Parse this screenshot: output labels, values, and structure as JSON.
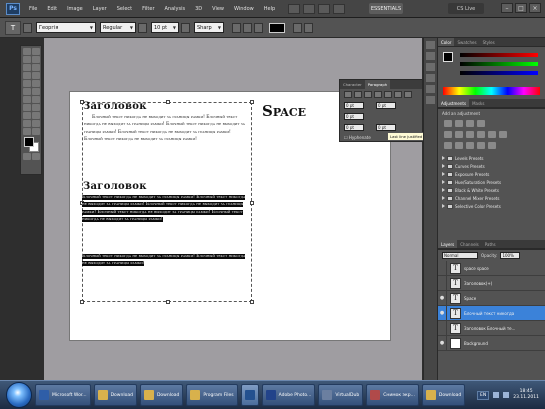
{
  "app": {
    "logo": "Ps",
    "menu": [
      "File",
      "Edit",
      "Image",
      "Layer",
      "Select",
      "Filter",
      "Analysis",
      "3D",
      "View",
      "Window",
      "Help"
    ],
    "workspace": "ESSENTIALS",
    "cs_live": "CS Live",
    "window_buttons": [
      "–",
      "□",
      "×"
    ]
  },
  "options_bar": {
    "tool_glyph": "T",
    "font_family": "Георгія",
    "font_style": "Regular",
    "font_size": "10 pt",
    "antialias": "Sharp",
    "text_color": "#000000"
  },
  "document": {
    "heading1": "Заголовок",
    "body1": "Блочный текст никогда не выходит за границы рамки! Блочный текст никогда не выходит за границы рамки! Блочный текст никогда не выходит за границы рамки! Блочный текст никогда не выходит за границы рамки! Блочный текст никогда не выходит за границы рамки!",
    "heading2": "Заголовок",
    "body2_selected": "Блочный текст никогда не выходит за границы рамки! Блочный текст никогда не выходит за границы рамки! Блочный текст никогда не выходит за границы рамки! Блочный текст никогда не выходит за границы рамки! Блочный текст никогда не выходит за границы рамки!",
    "body3_selected": "Блочный текст никогда не выходит за границы рамки! Блочный текст никогда не выходит за границы рамки!",
    "space_title": "Space"
  },
  "char_panel": {
    "tabs": [
      "Character",
      "Paragraph"
    ],
    "fields": [
      "0 pt",
      "0 pt",
      "0 pt",
      "0 pt",
      "0 pt"
    ],
    "hyphenate": "Hyphenate",
    "tooltip": "Last line justified paragraph"
  },
  "right_panels": {
    "color_tabs": [
      "Color",
      "Swatches",
      "Styles"
    ],
    "adjust_tabs": [
      "Adjustments",
      "Masks"
    ],
    "adjust_title": "Add an adjustment",
    "presets": [
      "Levels Presets",
      "Curves Presets",
      "Exposure Presets",
      "Hue/Saturation Presets",
      "Black & White Presets",
      "Channel Mixer Presets",
      "Selective Color Presets"
    ],
    "layers_tabs": [
      "Layers",
      "Channels",
      "Paths"
    ],
    "blend_mode": "Normal",
    "opacity_label": "Opacity:",
    "opacity": "100%",
    "layers": [
      {
        "name": "space space",
        "type": "T",
        "visible": false,
        "selected": false
      },
      {
        "name": "Заголовок(+)",
        "type": "T",
        "visible": false,
        "selected": false
      },
      {
        "name": "Space",
        "type": "T",
        "visible": true,
        "selected": false
      },
      {
        "name": "Блочный текст никогда",
        "type": "T",
        "visible": true,
        "selected": true
      },
      {
        "name": "Заголовок Блочный те...",
        "type": "T",
        "visible": false,
        "selected": false
      },
      {
        "name": "Background",
        "type": "bg",
        "visible": true,
        "selected": false
      }
    ]
  },
  "taskbar": {
    "tasks": [
      {
        "label": "Microsoft Wor...",
        "color": "#2f5ea8"
      },
      {
        "label": "Download",
        "color": "#d8b14c"
      },
      {
        "label": "Download",
        "color": "#d8b14c"
      },
      {
        "label": "Program Files",
        "color": "#d8b14c"
      },
      {
        "label": "",
        "color": "#23508f",
        "active": true
      },
      {
        "label": "Adobe Photo...",
        "color": "#22438a"
      },
      {
        "label": "VirtualDub",
        "color": "#6b7fa0"
      },
      {
        "label": "Снимок экр...",
        "color": "#b04a4a"
      },
      {
        "label": "Download",
        "color": "#d8b14c"
      }
    ],
    "language": "EN",
    "time": "18:45",
    "date": "23.11.2011"
  }
}
